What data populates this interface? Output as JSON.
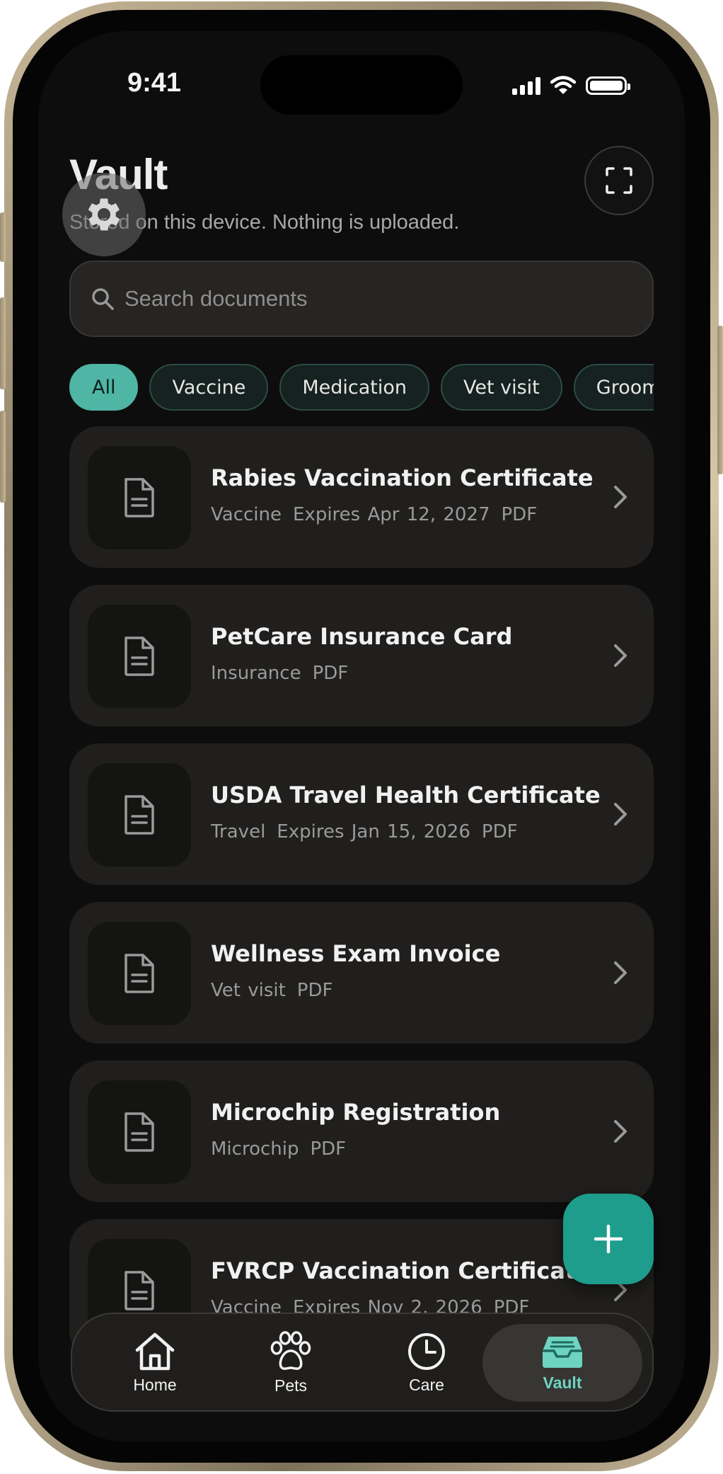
{
  "status_bar": {
    "time": "9:41"
  },
  "header": {
    "title": "Vault",
    "subtitle": "Stored on this device. Nothing is uploaded."
  },
  "search": {
    "placeholder": "Search documents",
    "value": ""
  },
  "filters": [
    "All",
    "Vaccine",
    "Medication",
    "Vet visit",
    "Grooming"
  ],
  "active_filter": "All",
  "documents": [
    {
      "title": "Rabies Vaccination Certificate",
      "category": "Vaccine",
      "expires": "Expires Apr 12, 2027",
      "format": "PDF"
    },
    {
      "title": "PetCare Insurance Card",
      "category": "Insurance",
      "expires": "",
      "format": "PDF"
    },
    {
      "title": "USDA Travel Health Certificate",
      "category": "Travel",
      "expires": "Expires Jan 15, 2026",
      "format": "PDF"
    },
    {
      "title": "Wellness Exam Invoice",
      "category": "Vet visit",
      "expires": "",
      "format": "PDF"
    },
    {
      "title": "Microchip Registration",
      "category": "Microchip",
      "expires": "",
      "format": "PDF"
    },
    {
      "title": "FVRCP Vaccination Certificate",
      "category": "Vaccine",
      "expires": "Expires Nov 2, 2026",
      "format": "PDF"
    }
  ],
  "tabs": [
    {
      "label": "Home",
      "icon": "home-icon"
    },
    {
      "label": "Pets",
      "icon": "paw-icon"
    },
    {
      "label": "Care",
      "icon": "clock-icon"
    },
    {
      "label": "Vault",
      "icon": "inbox-tray-icon"
    }
  ],
  "active_tab": "Vault",
  "colors": {
    "accent": "#4fb5a4",
    "fab": "#1e9c8c",
    "active_tab_label": "#6ed3c1",
    "background": "#0d0d0d",
    "card": "#201f1d"
  }
}
